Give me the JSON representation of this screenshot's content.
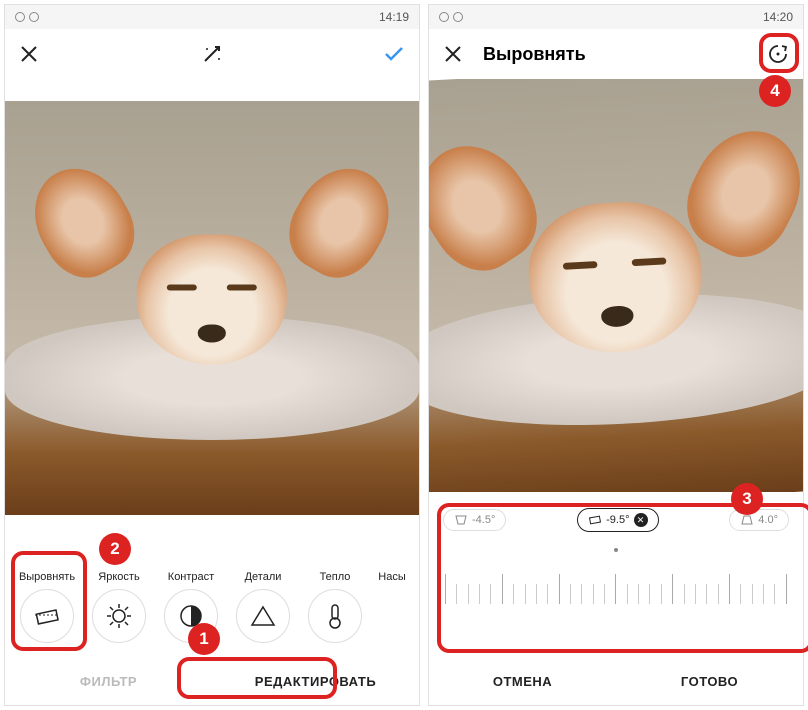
{
  "left": {
    "statusTime": "14:19",
    "tools": [
      {
        "label": "Выровнять",
        "icon": "straighten"
      },
      {
        "label": "Яркость",
        "icon": "brightness"
      },
      {
        "label": "Контраст",
        "icon": "contrast"
      },
      {
        "label": "Детали",
        "icon": "triangle"
      },
      {
        "label": "Тепло",
        "icon": "thermometer"
      },
      {
        "label": "Насы",
        "icon": "partial"
      }
    ],
    "tabs": {
      "filter": "ФИЛЬТР",
      "edit": "РЕДАКТИРОВАТЬ"
    }
  },
  "right": {
    "statusTime": "14:20",
    "headerTitle": "Выровнять",
    "presets": {
      "left": "-4.5°",
      "center": "-9.5°",
      "right": "4.0°"
    },
    "tabs": {
      "cancel": "ОТМЕНА",
      "done": "ГОТОВО"
    }
  },
  "markers": {
    "m1": "1",
    "m2": "2",
    "m3": "3",
    "m4": "4"
  }
}
